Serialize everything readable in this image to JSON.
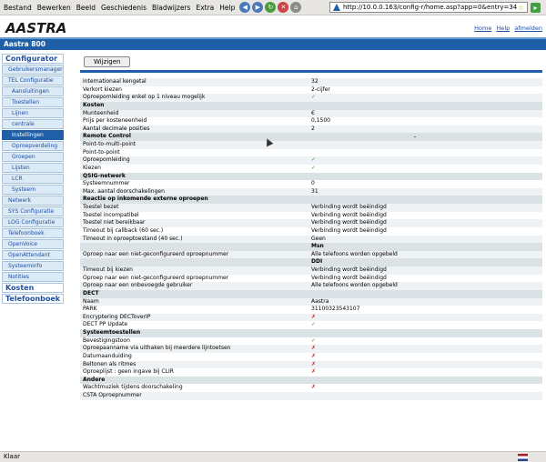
{
  "browser": {
    "menus": [
      "Bestand",
      "Bewerken",
      "Beeld",
      "Geschiedenis",
      "Bladwijzers",
      "Extra",
      "Help"
    ],
    "url": "http://10.0.0.163/config-r/home.asp?app=0&entry=34",
    "status": "Klaar"
  },
  "header": {
    "logo": "AASTRA",
    "links": [
      "Home",
      "Help",
      "afmelden"
    ],
    "title": "Aastra 800"
  },
  "sidebar": {
    "items": [
      {
        "label": "Configurator",
        "level": "head"
      },
      {
        "label": "Gebruikersmanager",
        "level": "l1"
      },
      {
        "label": "TEL Configuratie",
        "level": "l1"
      },
      {
        "label": "Aansluitingen",
        "level": "l2"
      },
      {
        "label": "Toestellen",
        "level": "l2"
      },
      {
        "label": "Lijnen",
        "level": "l2"
      },
      {
        "label": "centrale",
        "level": "l2"
      },
      {
        "label": "Instellingen",
        "level": "l2",
        "active": true
      },
      {
        "label": "Oproepverdeling",
        "level": "l2"
      },
      {
        "label": "Groepen",
        "level": "l2"
      },
      {
        "label": "Lijsten",
        "level": "l2"
      },
      {
        "label": "LCR",
        "level": "l2"
      },
      {
        "label": "Systeem",
        "level": "l2"
      },
      {
        "label": "Netwerk",
        "level": "l1"
      },
      {
        "label": "SYS Configuratie",
        "level": "l1"
      },
      {
        "label": "LOG Configuratie",
        "level": "l1"
      },
      {
        "label": "Telefoonboek",
        "level": "l1"
      },
      {
        "label": "OpenVoice",
        "level": "l1"
      },
      {
        "label": "OpenAttendant",
        "level": "l1"
      },
      {
        "label": "Systeeminfo",
        "level": "l1"
      },
      {
        "label": "Notities",
        "level": "l1"
      },
      {
        "label": "Kosten",
        "level": "head"
      },
      {
        "label": "Telefoonboek",
        "level": "head"
      }
    ]
  },
  "main": {
    "button": "Wijzigen",
    "rows": [
      {
        "label": "internationaal kengetal",
        "value": "32"
      },
      {
        "label": "Verkort kiezen",
        "value": "2-cijfer"
      },
      {
        "label": "Oproepomleiding enkel op 1 niveau mogelijk",
        "value": "✓",
        "kind": "yes"
      },
      {
        "label": "Kosten",
        "section": true
      },
      {
        "label": "Munteenheid",
        "value": "€"
      },
      {
        "label": "Prijs per kosteneenheid",
        "value": "0,1500"
      },
      {
        "label": "Aantal decimale posities",
        "value": "2"
      },
      {
        "label": "Remote Control",
        "section": true
      },
      {
        "label": "Point-to-multi-point",
        "value": ""
      },
      {
        "label": "Point-to-point",
        "value": ""
      },
      {
        "label": "Oproepomleiding",
        "value": "✓",
        "kind": "yes"
      },
      {
        "label": "Kiezen",
        "value": "✓",
        "kind": "yes"
      },
      {
        "label": "QSIG-netwerk",
        "section": true
      },
      {
        "label": "Systeemnummer",
        "value": "0"
      },
      {
        "label": "Max. aantal doorschakelingen",
        "value": "31"
      },
      {
        "label": "Reactie op inkomende externe oproepen",
        "section": true
      },
      {
        "label": "Toestel bezet",
        "value": "Verbinding wordt beëindigd"
      },
      {
        "label": "Toestel incompatibel",
        "value": "Verbinding wordt beëindigd"
      },
      {
        "label": "Toestel niet bereikbaar",
        "value": "Verbinding wordt beëindigd"
      },
      {
        "label": "Timeout bij callback (60 sec.)",
        "value": "Verbinding wordt beëindigd"
      },
      {
        "label": "Timeout in oproeptoestand (40 sec.)",
        "value": "Geen"
      },
      {
        "label": "",
        "value": "Msn",
        "section": true
      },
      {
        "label": "Oproep naar een niet-geconfigureerd oproepnummer",
        "value": "Alle telefoons worden opgebeld"
      },
      {
        "label": "",
        "value": "DDI",
        "section": true
      },
      {
        "label": "Timeout bij kiezen",
        "value": "Verbinding wordt beëindigd"
      },
      {
        "label": "Oproep naar een niet-geconfigureerd oproepnummer",
        "value": "Verbinding wordt beëindigd"
      },
      {
        "label": "Oproep naar een onbevoegde gebruiker",
        "value": "Alle telefoons worden opgebeld"
      },
      {
        "label": "DECT",
        "section": true
      },
      {
        "label": "Naam",
        "value": "Aastra"
      },
      {
        "label": "PARK",
        "value": "31100323543107"
      },
      {
        "label": "Encryptering DECToverIP",
        "value": "✗",
        "kind": "no"
      },
      {
        "label": "DECT PP Update",
        "value": "✓",
        "kind": "yes"
      },
      {
        "label": "Systeemtoestellen",
        "section": true
      },
      {
        "label": "Bevestigingstoon",
        "value": "✓",
        "kind": "yes"
      },
      {
        "label": "Oproepaanname via uithaken bij meerdere lijntoetsen",
        "value": "✗",
        "kind": "no"
      },
      {
        "label": "Datumaanduiding",
        "value": "✗",
        "kind": "no"
      },
      {
        "label": "Beltonen als ritmes",
        "value": "✗",
        "kind": "no"
      },
      {
        "label": "Oproeplijst : geen ingave bij CLIR",
        "value": "✗",
        "kind": "no"
      },
      {
        "label": "Andere",
        "section": true
      },
      {
        "label": "Wachtmuziek tijdens doorschakeling",
        "value": "✗",
        "kind": "no"
      },
      {
        "label": "CSTA Oproepnummer",
        "value": ""
      }
    ]
  }
}
